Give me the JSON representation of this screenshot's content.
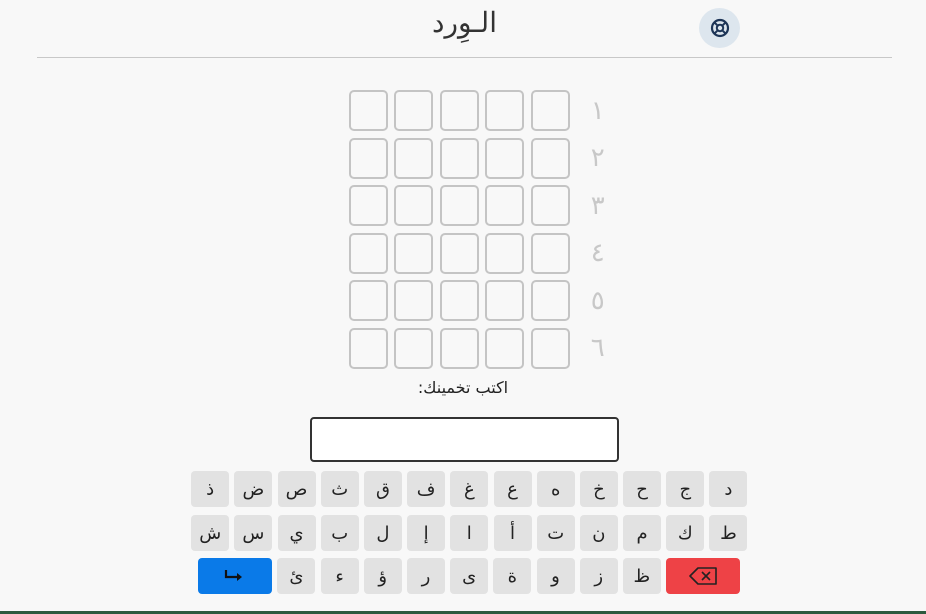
{
  "header": {
    "title": "الـوِرد",
    "help_icon": "help-circle-icon"
  },
  "board": {
    "row_numbers": [
      "١",
      "٢",
      "٣",
      "٤",
      "٥",
      "٦"
    ],
    "columns": 5
  },
  "prompt": "اكتب تخمينك:",
  "input": {
    "value": "",
    "placeholder": ""
  },
  "keyboard": {
    "row1": [
      "د",
      "ج",
      "ح",
      "خ",
      "ه",
      "ع",
      "غ",
      "ف",
      "ق",
      "ث",
      "ص",
      "ض",
      "ذ"
    ],
    "row2": [
      "ط",
      "ك",
      "م",
      "ن",
      "ت",
      "أ",
      "ا",
      "إ",
      "ل",
      "ب",
      "ي",
      "س",
      "ش"
    ],
    "row3": [
      "ظ",
      "ز",
      "و",
      "ة",
      "ى",
      "ر",
      "ؤ",
      "ء",
      "ئ"
    ],
    "enter_icon": "enter-arrow-icon",
    "delete_icon": "backspace-icon"
  },
  "colors": {
    "enter_key": "#0a7ae8",
    "delete_key": "#ee4246",
    "key_bg": "#e2e2e2",
    "cell_border": "#c4c4c4"
  }
}
